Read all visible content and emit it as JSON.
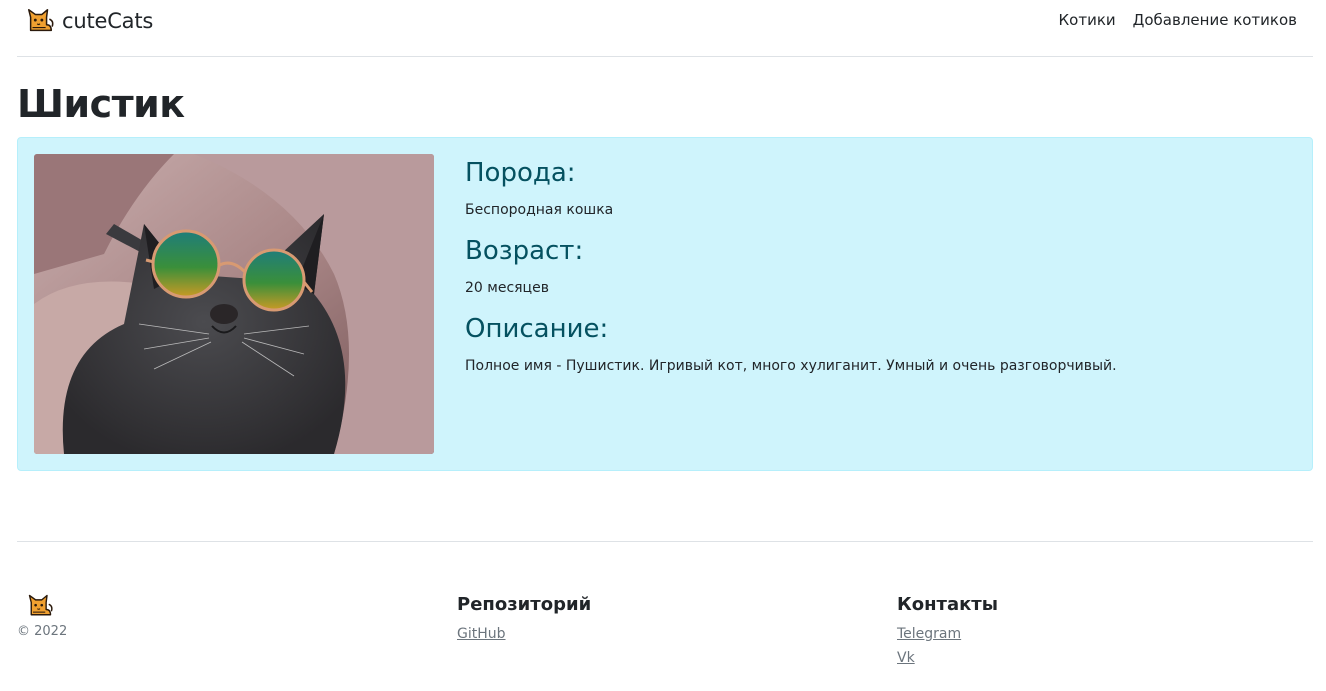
{
  "brand": {
    "name": "cuteCats",
    "icon": "cat-logo-icon"
  },
  "nav": {
    "items": [
      {
        "label": "Котики"
      },
      {
        "label": "Добавление котиков"
      }
    ]
  },
  "page": {
    "title": "Шистик"
  },
  "cat": {
    "photo_icon": "cat-photo",
    "breed_heading": "Порода:",
    "breed": "Беспородная кошка",
    "age_heading": "Возраст:",
    "age": "20 месяцев",
    "description_heading": "Описание:",
    "description": "Полное имя - Пушистик. Игривый кот, много хулиганит. Умный и очень разговорчивый."
  },
  "footer": {
    "copyright": "© 2022",
    "repo_heading": "Репозиторий",
    "repo_links": [
      {
        "label": "GitHub"
      }
    ],
    "contacts_heading": "Контакты",
    "contact_links": [
      {
        "label": "Telegram"
      },
      {
        "label": "Vk"
      }
    ]
  },
  "colors": {
    "card_bg": "#cff4fc",
    "heading": "#055160",
    "link_muted": "#6c757d"
  }
}
